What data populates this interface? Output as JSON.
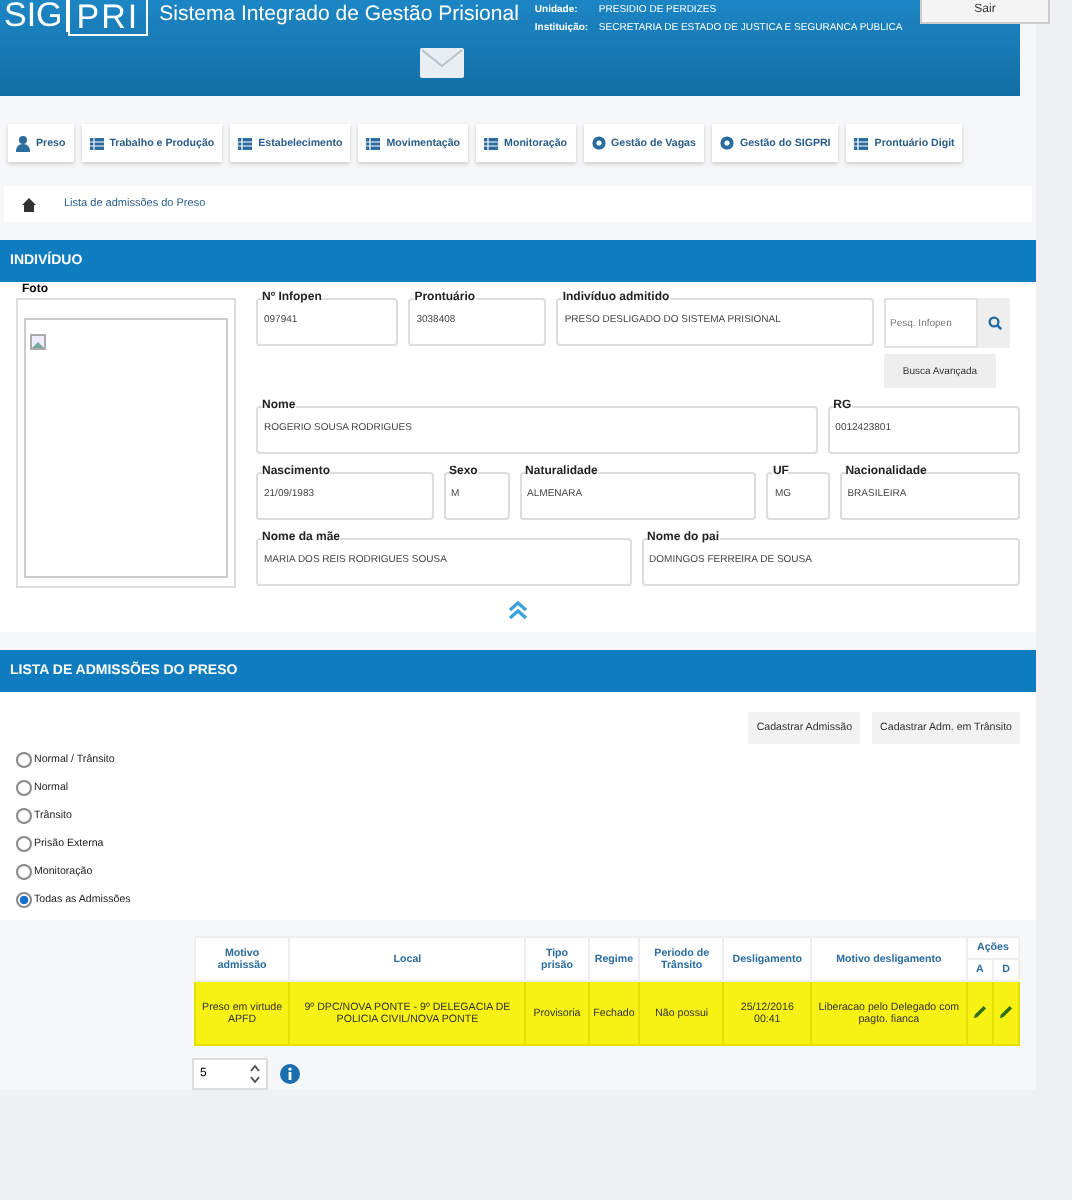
{
  "header": {
    "logo_left": "SIG",
    "logo_right": "PRI",
    "title": "Sistema Integrado de Gestão Prisional",
    "unit_label": "Unidade:",
    "unit": "PRESIDIO DE PERDIZES",
    "institution_label": "Instituição:",
    "institution": "SECRETARIA DE ESTADO DE JUSTICA E SEGURANCA PUBLICA",
    "logout": "Sair"
  },
  "nav": [
    {
      "label": "Preso",
      "kind": "person"
    },
    {
      "label": "Trabalho e Produção",
      "kind": "module"
    },
    {
      "label": "Estabelecimento",
      "kind": "module"
    },
    {
      "label": "Movimentação",
      "kind": "module"
    },
    {
      "label": "Monitoração",
      "kind": "module"
    },
    {
      "label": "Gestão de Vagas",
      "kind": "admin"
    },
    {
      "label": "Gestão do SIGPRI",
      "kind": "admin"
    },
    {
      "label": "Prontuário Digit",
      "kind": "module"
    }
  ],
  "breadcrumb": "Lista de admissões do Preso",
  "individual": {
    "title": "INDIVÍDUO",
    "photo_label": "Foto",
    "fields": [
      {
        "label": "Nº Infopen",
        "value": "097941"
      },
      {
        "label": "Prontuário",
        "value": "3038408"
      },
      {
        "label": "Indivíduo admitido",
        "value": "PRESO DESLIGADO DO SISTEMA PRISIONAL"
      },
      {
        "label": "Nome",
        "value": "ROGERIO SOUSA RODRIGUES"
      },
      {
        "label": "RG",
        "value": "0012423801"
      },
      {
        "label": "Nascimento",
        "value": "21/09/1983"
      },
      {
        "label": "Sexo",
        "value": "M"
      },
      {
        "label": "Naturalidade",
        "value": "ALMENARA"
      },
      {
        "label": "UF",
        "value": "MG"
      },
      {
        "label": "Nacionalidade",
        "value": "BRASILEIRA"
      },
      {
        "label": "Nome da mãe",
        "value": "MARIA DOS REIS RODRIGUES SOUSA"
      },
      {
        "label": "Nome do pai",
        "value": "DOMINGOS FERREIRA DE SOUSA"
      }
    ],
    "search": {
      "placeholder": "Pesq. Infopen"
    },
    "advanced_search": "Busca Avançada"
  },
  "admissions": {
    "title": "LISTA DE ADMISSÕES DO PRESO",
    "buttons": [
      "Cadastrar Admissão",
      "Cadastrar Adm. em Trânsito"
    ],
    "filters": [
      {
        "label": "Normal / Trânsito",
        "selected": false
      },
      {
        "label": "Normal",
        "selected": false
      },
      {
        "label": "Trânsito",
        "selected": false
      },
      {
        "label": "Prisão Externa",
        "selected": false
      },
      {
        "label": "Monitoração",
        "selected": false
      },
      {
        "label": "Todas as Admissões",
        "selected": true
      }
    ],
    "table": {
      "columns": [
        "Motivo admissão",
        "Local",
        "Tipo prisão",
        "Regime",
        "Periodo de Trânsito",
        "Desligamento",
        "Motivo desligamento"
      ],
      "actions": "Ações",
      "action_columns": [
        "A",
        "D"
      ],
      "rows": [
        {
          "cells": [
            "Preso em virtude APFD",
            "9º DPC/NOVA PONTE - 9º DELEGACIA DE POLICIA CIVIL/NOVA PONTE",
            "Provisoria",
            "Fechado",
            "Não possui",
            "25/12/2016 00:41",
            "Liberacao pelo Delegado com pagto. fianca"
          ],
          "highlighted": true
        }
      ]
    },
    "page_size": "5"
  }
}
